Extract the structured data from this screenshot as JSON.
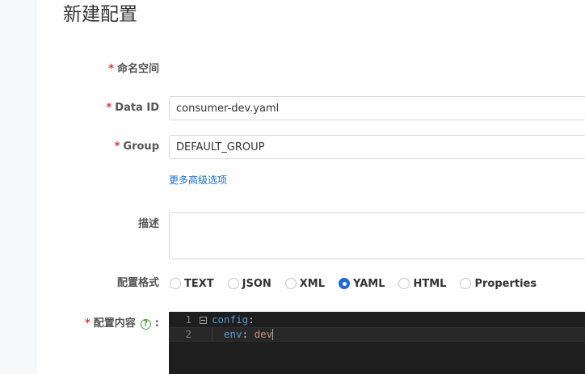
{
  "page": {
    "title": "新建配置"
  },
  "form": {
    "namespace": {
      "required_mark": "*",
      "label": "命名空间"
    },
    "data_id": {
      "required_mark": "*",
      "label": "Data ID",
      "value": "consumer-dev.yaml"
    },
    "group": {
      "required_mark": "*",
      "label": "Group",
      "value": "DEFAULT_GROUP"
    },
    "advanced_link": "更多高级选项",
    "description": {
      "label": "描述",
      "value": ""
    },
    "format": {
      "label": "配置格式",
      "options": [
        "TEXT",
        "JSON",
        "XML",
        "YAML",
        "HTML",
        "Properties"
      ],
      "selected": "YAML"
    },
    "content": {
      "required_mark": "*",
      "label": "配置内容",
      "help_icon": "question-circle-icon",
      "colon": ":"
    }
  },
  "editor": {
    "lines": [
      {
        "number": "1",
        "key": "config",
        "punct": ":",
        "value": ""
      },
      {
        "number": "2",
        "key": "env",
        "punct": ": ",
        "value": "dev"
      }
    ]
  },
  "colors": {
    "accent": "#1f6bd1",
    "required": "#d9363e",
    "help": "#4aa13a",
    "editor_bg": "#1e1e1e",
    "yaml_key": "#569cd6",
    "yaml_value": "#ce9178"
  }
}
